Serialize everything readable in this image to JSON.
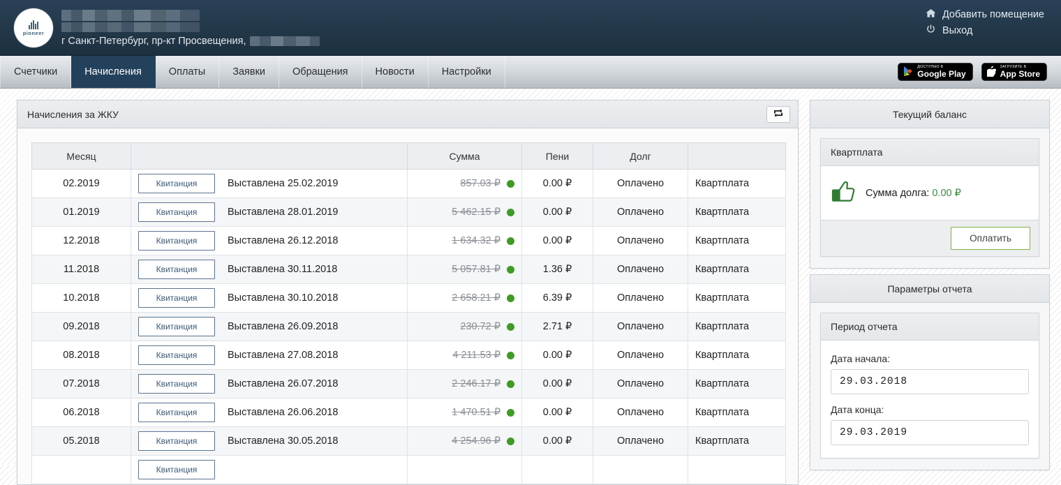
{
  "brand": {
    "logo_text": "pioneer"
  },
  "header": {
    "account_redacted": true,
    "address": "г Санкт-Петербург, пр-кт Просвещения,",
    "links": [
      {
        "label": "Добавить помещение",
        "icon": "home-icon"
      },
      {
        "label": "Выход",
        "icon": "power-icon"
      }
    ]
  },
  "nav": {
    "tabs": [
      {
        "label": "Счетчики",
        "active": false
      },
      {
        "label": "Начисления",
        "active": true
      },
      {
        "label": "Оплаты",
        "active": false
      },
      {
        "label": "Заявки",
        "active": false
      },
      {
        "label": "Обращения",
        "active": false
      },
      {
        "label": "Новости",
        "active": false
      },
      {
        "label": "Настройки",
        "active": false
      }
    ],
    "store_badges": [
      {
        "small": "Доступно в",
        "big": "Google Play",
        "icon": "google-play-icon"
      },
      {
        "small": "Загрузите в",
        "big": "App Store",
        "icon": "apple-icon"
      }
    ]
  },
  "main_panel": {
    "title": "Начисления за ЖКУ",
    "refresh_icon": "repeat-arrows-icon"
  },
  "table": {
    "columns": [
      "Месяц",
      "",
      "Сумма",
      "Пени",
      "Долг",
      ""
    ],
    "receipt_button_label": "Квитанция",
    "currency": "₽",
    "status_dot_color": "#3e9b23",
    "rows": [
      {
        "month": "02.2019",
        "issued": "Выставлена 25.02.2019",
        "sum": "857.03 ₽",
        "peni": "0.00 ₽",
        "peni_due": false,
        "debt": "Оплачено",
        "type": "Квартплата"
      },
      {
        "month": "01.2019",
        "issued": "Выставлена 28.01.2019",
        "sum": "5 462.15 ₽",
        "peni": "0.00 ₽",
        "peni_due": false,
        "debt": "Оплачено",
        "type": "Квартплата"
      },
      {
        "month": "12.2018",
        "issued": "Выставлена 26.12.2018",
        "sum": "1 634.32 ₽",
        "peni": "0.00 ₽",
        "peni_due": false,
        "debt": "Оплачено",
        "type": "Квартплата"
      },
      {
        "month": "11.2018",
        "issued": "Выставлена 30.11.2018",
        "sum": "5 057.81 ₽",
        "peni": "1.36 ₽",
        "peni_due": true,
        "debt": "Оплачено",
        "type": "Квартплата"
      },
      {
        "month": "10.2018",
        "issued": "Выставлена 30.10.2018",
        "sum": "2 658.21 ₽",
        "peni": "6.39 ₽",
        "peni_due": true,
        "debt": "Оплачено",
        "type": "Квартплата"
      },
      {
        "month": "09.2018",
        "issued": "Выставлена 26.09.2018",
        "sum": "230.72 ₽",
        "peni": "2.71 ₽",
        "peni_due": true,
        "debt": "Оплачено",
        "type": "Квартплата"
      },
      {
        "month": "08.2018",
        "issued": "Выставлена 27.08.2018",
        "sum": "4 211.53 ₽",
        "peni": "0.00 ₽",
        "peni_due": false,
        "debt": "Оплачено",
        "type": "Квартплата"
      },
      {
        "month": "07.2018",
        "issued": "Выставлена 26.07.2018",
        "sum": "2 246.17 ₽",
        "peni": "0.00 ₽",
        "peni_due": false,
        "debt": "Оплачено",
        "type": "Квартплата"
      },
      {
        "month": "06.2018",
        "issued": "Выставлена 26.06.2018",
        "sum": "1 470.51 ₽",
        "peni": "0.00 ₽",
        "peni_due": false,
        "debt": "Оплачено",
        "type": "Квартплата"
      },
      {
        "month": "05.2018",
        "issued": "Выставлена 30.05.2018",
        "sum": "4 254.96 ₽",
        "peni": "0.00 ₽",
        "peni_due": false,
        "debt": "Оплачено",
        "type": "Квартплата"
      },
      {
        "month": "",
        "issued": "",
        "sum": "",
        "peni": "",
        "peni_due": false,
        "debt": "",
        "type": ""
      }
    ]
  },
  "sidebar": {
    "balance_panel_title": "Текущий баланс",
    "balance_card": {
      "title": "Квартплата",
      "debt_label": "Сумма долга:",
      "debt_value": "0.00 ₽",
      "debt_color": "#3d8b3d",
      "icon": "thumbs-up-icon",
      "pay_button": "Оплатить"
    },
    "report_panel_title": "Параметры отчета",
    "report_card": {
      "title": "Период отчета",
      "start_label": "Дата начала:",
      "start_value": "29.03.2018",
      "end_label": "Дата конца:",
      "end_value": "29.03.2019"
    }
  }
}
